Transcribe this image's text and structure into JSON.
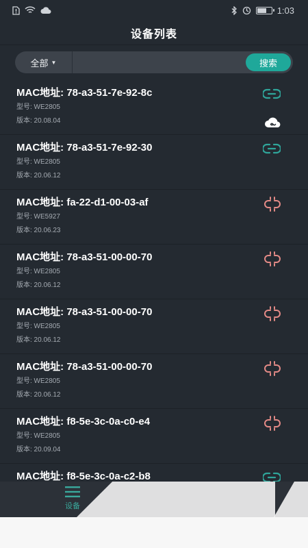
{
  "status_bar": {
    "time": "1:03",
    "battery_level": 0.65
  },
  "header": {
    "title": "设备列表"
  },
  "search": {
    "filter_label": "全部",
    "placeholder": "",
    "value": "",
    "button_label": "搜索"
  },
  "devices": [
    {
      "mac": "MAC地址: 78-a3-51-7e-92-8c",
      "model": "型号: WE2805",
      "version": "版本: 20.08.04",
      "status": "linked",
      "cloud": true
    },
    {
      "mac": "MAC地址: 78-a3-51-7e-92-30",
      "model": "型号: WE2805",
      "version": "版本: 20.06.12",
      "status": "linked",
      "cloud": false
    },
    {
      "mac": "MAC地址: fa-22-d1-00-03-af",
      "model": "型号: WE5927",
      "version": "版本: 20.06.23",
      "status": "unlinked",
      "cloud": false
    },
    {
      "mac": "MAC地址: 78-a3-51-00-00-70",
      "model": "型号: WE2805",
      "version": "版本: 20.06.12",
      "status": "unlinked",
      "cloud": false
    },
    {
      "mac": "MAC地址: 78-a3-51-00-00-70",
      "model": "型号: WE2805",
      "version": "版本: 20.06.12",
      "status": "unlinked",
      "cloud": false
    },
    {
      "mac": "MAC地址: 78-a3-51-00-00-70",
      "model": "型号: WE2805",
      "version": "版本: 20.06.12",
      "status": "unlinked",
      "cloud": false
    },
    {
      "mac": "MAC地址: f8-5e-3c-0a-c0-e4",
      "model": "型号: WE2805",
      "version": "版本: 20.09.04",
      "status": "unlinked",
      "cloud": false
    },
    {
      "mac": "MAC地址: f8-5e-3c-0a-c2-b8",
      "model": "",
      "version": "",
      "status": "linked",
      "cloud": false
    }
  ],
  "tab_bar": {
    "active_label": "设备"
  },
  "colors": {
    "background": "#242a31",
    "accent": "#1fa89a",
    "linked": "#2fa59a",
    "unlinked": "#e48a86",
    "meta_text": "#a5abb2"
  }
}
